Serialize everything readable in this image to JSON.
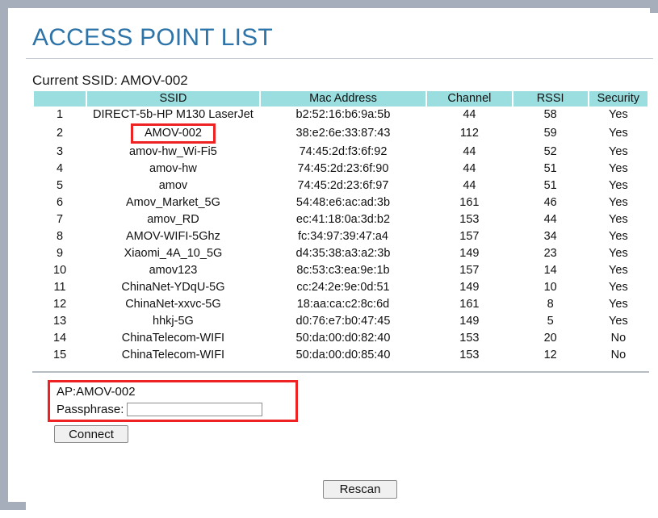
{
  "window": {
    "title": "ACCESS POINT LIST"
  },
  "status": {
    "current_ssid_line": "Current SSID: AMOV-002"
  },
  "table": {
    "columns": [
      "",
      "SSID",
      "Mac Address",
      "Channel",
      "RSSI",
      "Security"
    ],
    "highlighted_row_index": 2,
    "rows": [
      {
        "index": "1",
        "ssid": "DIRECT-5b-HP M130 LaserJet",
        "mac": "b2:52:16:b6:9a:5b",
        "channel": "44",
        "rssi": "58",
        "security": "Yes"
      },
      {
        "index": "2",
        "ssid": "AMOV-002",
        "mac": "38:e2:6e:33:87:43",
        "channel": "112",
        "rssi": "59",
        "security": "Yes"
      },
      {
        "index": "3",
        "ssid": "amov-hw_Wi-Fi5",
        "mac": "74:45:2d:f3:6f:92",
        "channel": "44",
        "rssi": "52",
        "security": "Yes"
      },
      {
        "index": "4",
        "ssid": "amov-hw",
        "mac": "74:45:2d:23:6f:90",
        "channel": "44",
        "rssi": "51",
        "security": "Yes"
      },
      {
        "index": "5",
        "ssid": "amov",
        "mac": "74:45:2d:23:6f:97",
        "channel": "44",
        "rssi": "51",
        "security": "Yes"
      },
      {
        "index": "6",
        "ssid": "Amov_Market_5G",
        "mac": "54:48:e6:ac:ad:3b",
        "channel": "161",
        "rssi": "46",
        "security": "Yes"
      },
      {
        "index": "7",
        "ssid": "amov_RD",
        "mac": "ec:41:18:0a:3d:b2",
        "channel": "153",
        "rssi": "44",
        "security": "Yes"
      },
      {
        "index": "8",
        "ssid": "AMOV-WIFI-5Ghz",
        "mac": "fc:34:97:39:47:a4",
        "channel": "157",
        "rssi": "34",
        "security": "Yes"
      },
      {
        "index": "9",
        "ssid": "Xiaomi_4A_10_5G",
        "mac": "d4:35:38:a3:a2:3b",
        "channel": "149",
        "rssi": "23",
        "security": "Yes"
      },
      {
        "index": "10",
        "ssid": "amov123",
        "mac": "8c:53:c3:ea:9e:1b",
        "channel": "157",
        "rssi": "14",
        "security": "Yes"
      },
      {
        "index": "11",
        "ssid": "ChinaNet-YDqU-5G",
        "mac": "cc:24:2e:9e:0d:51",
        "channel": "149",
        "rssi": "10",
        "security": "Yes"
      },
      {
        "index": "12",
        "ssid": "ChinaNet-xxvc-5G",
        "mac": "18:aa:ca:c2:8c:6d",
        "channel": "161",
        "rssi": "8",
        "security": "Yes"
      },
      {
        "index": "13",
        "ssid": "hhkj-5G",
        "mac": "d0:76:e7:b0:47:45",
        "channel": "149",
        "rssi": "5",
        "security": "Yes"
      },
      {
        "index": "14",
        "ssid": "ChinaTelecom-WIFI",
        "mac": "50:da:00:d0:82:40",
        "channel": "153",
        "rssi": "20",
        "security": "No"
      },
      {
        "index": "15",
        "ssid": "ChinaTelecom-WIFI",
        "mac": "50:da:00:d0:85:40",
        "channel": "153",
        "rssi": "12",
        "security": "No"
      }
    ]
  },
  "connect_form": {
    "ap_label": "AP:AMOV-002",
    "passphrase_label": "Passphrase:",
    "passphrase_value": "",
    "passphrase_placeholder": "",
    "connect_label": "Connect"
  },
  "actions": {
    "rescan_label": "Rescan"
  },
  "colors": {
    "title_blue": "#2e74a8",
    "header_cyan": "#9adee0",
    "annotation_red": "#ee2222",
    "frame_gray": "#a5aeba"
  }
}
